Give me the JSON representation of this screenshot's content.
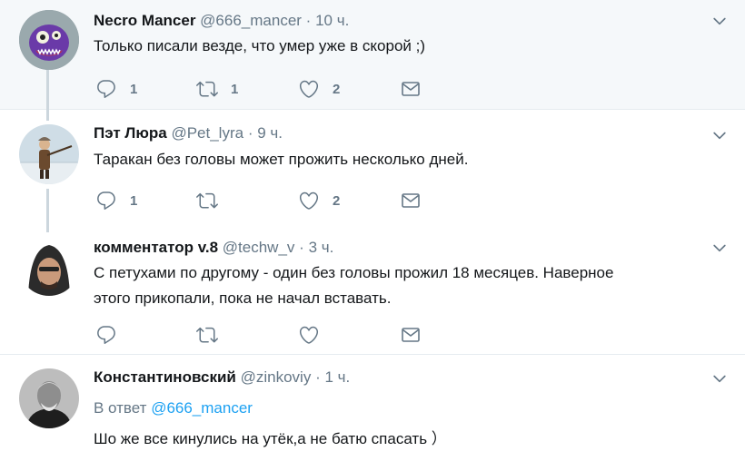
{
  "tweets": [
    {
      "name": "Necro Mancer",
      "handle": "@666_mancer",
      "dot": "·",
      "time": "10 ч.",
      "text": "Только писали везде, что умер уже в скорой ;)",
      "replies": "1",
      "retweets": "1",
      "likes": "2"
    },
    {
      "name": "Пэт Люра",
      "handle": "@Pet_lyra",
      "dot": "·",
      "time": "9 ч.",
      "text": "Таракан без головы может прожить несколько дней.",
      "replies": "1",
      "retweets": "",
      "likes": "2"
    },
    {
      "name": "комментатор v.8",
      "handle": "@techw_v",
      "dot": "·",
      "time": "3 ч.",
      "text_line1": "С петухами по другому - один без головы прожил 18 месяцев. Наверное",
      "text_line2": "этого прикопали, пока не начал вставать."
    },
    {
      "name": "Константиновский",
      "handle": "@zinkoviy",
      "dot": "·",
      "time": "1 ч.",
      "reply_prefix": "В ответ",
      "reply_to": "@666_mancer",
      "text": "Шо же все кинулись на утёк,а не батю спасать ）"
    }
  ],
  "colors": {
    "highlight_bg": "#f5f8fa",
    "text": "#14171a",
    "muted": "#657786",
    "accent": "#1da1f2",
    "thread_line": "#ccd6dd",
    "divider": "#e6ecf0"
  },
  "icons": [
    "reply-icon",
    "retweet-icon",
    "like-icon",
    "dm-icon",
    "chevron-down-icon"
  ]
}
